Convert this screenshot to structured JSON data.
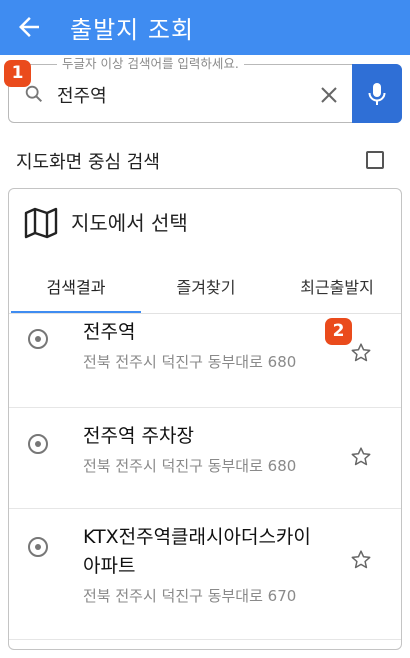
{
  "appbar": {
    "title": "출발지 조회"
  },
  "search": {
    "legend": "두글자 이상 검색어를 입력하세요.",
    "value": "전주역"
  },
  "badges": {
    "first": "1",
    "second": "2"
  },
  "center_search": {
    "label": "지도화면 중심 검색",
    "checked": false
  },
  "map_select": {
    "label": "지도에서 선택"
  },
  "tabs": [
    {
      "label": "검색결과",
      "active": true
    },
    {
      "label": "즐겨찾기",
      "active": false
    },
    {
      "label": "최근출발지",
      "active": false
    }
  ],
  "results": [
    {
      "name": "전주역",
      "address": "전북 전주시 덕진구 동부대로 680"
    },
    {
      "name": "전주역 주차장",
      "address": "전북 전주시 덕진구 동부대로 680"
    },
    {
      "name": "KTX전주역클래시아더스카이아파트",
      "address": "전북 전주시 덕진구 동부대로 670"
    }
  ],
  "colors": {
    "appbar": "#3f8cf1",
    "mic_button": "#2f6fd6",
    "badge": "#ea4b1c"
  }
}
